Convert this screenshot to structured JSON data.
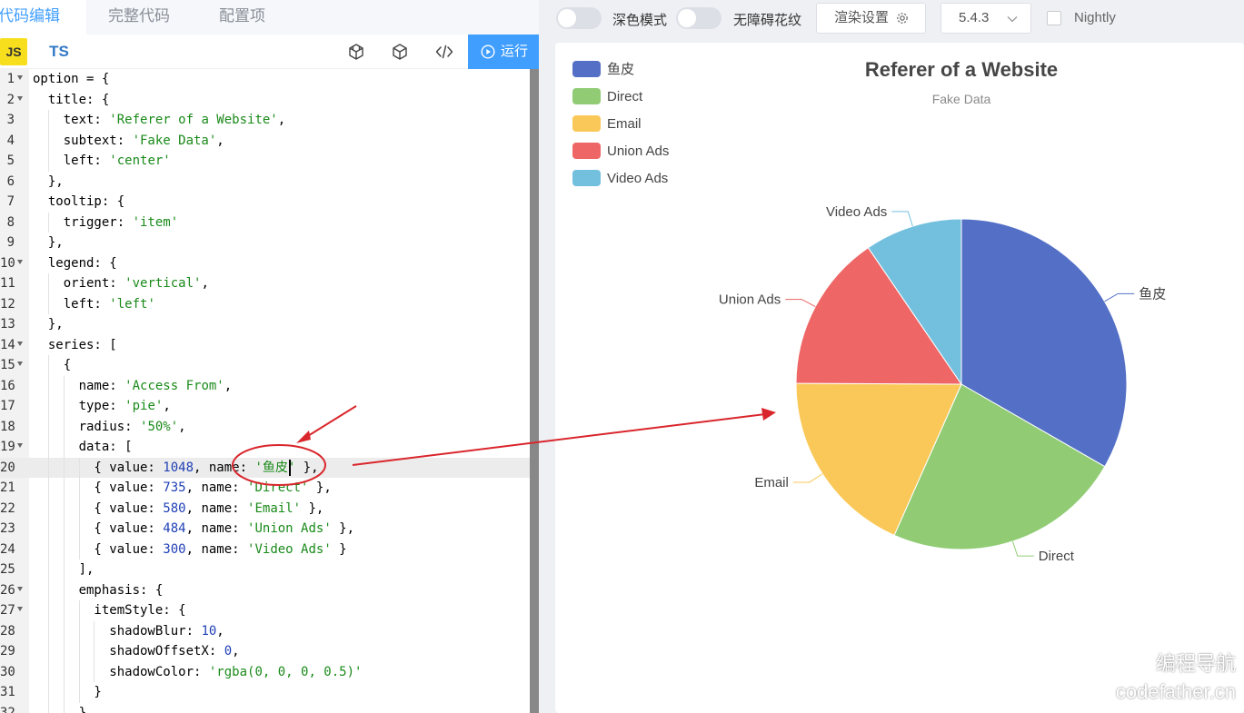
{
  "editor_tabs": [
    "代码编辑",
    "完整代码",
    "配置项"
  ],
  "toolbar": {
    "js_label": "JS",
    "ts_label": "TS",
    "run_label": "运行",
    "icons": [
      "codesandbox-icon",
      "cube-icon",
      "code-icon"
    ]
  },
  "code_lines": [
    [
      [
        "k",
        "option = {"
      ]
    ],
    [
      [
        "k",
        "  title: {"
      ]
    ],
    [
      [
        "k",
        "    text: "
      ],
      [
        "s",
        "'Referer of a Website'"
      ],
      [
        "k",
        ","
      ]
    ],
    [
      [
        "k",
        "    subtext: "
      ],
      [
        "s",
        "'Fake Data'"
      ],
      [
        "k",
        ","
      ]
    ],
    [
      [
        "k",
        "    left: "
      ],
      [
        "s",
        "'center'"
      ]
    ],
    [
      [
        "k",
        "  },"
      ]
    ],
    [
      [
        "k",
        "  tooltip: {"
      ]
    ],
    [
      [
        "k",
        "    trigger: "
      ],
      [
        "s",
        "'item'"
      ]
    ],
    [
      [
        "k",
        "  },"
      ]
    ],
    [
      [
        "k",
        "  legend: {"
      ]
    ],
    [
      [
        "k",
        "    orient: "
      ],
      [
        "s",
        "'vertical'"
      ],
      [
        "k",
        ","
      ]
    ],
    [
      [
        "k",
        "    left: "
      ],
      [
        "s",
        "'left'"
      ]
    ],
    [
      [
        "k",
        "  },"
      ]
    ],
    [
      [
        "k",
        "  series: ["
      ]
    ],
    [
      [
        "k",
        "    {"
      ]
    ],
    [
      [
        "k",
        "      name: "
      ],
      [
        "s",
        "'Access From'"
      ],
      [
        "k",
        ","
      ]
    ],
    [
      [
        "k",
        "      type: "
      ],
      [
        "s",
        "'pie'"
      ],
      [
        "k",
        ","
      ]
    ],
    [
      [
        "k",
        "      radius: "
      ],
      [
        "s",
        "'50%'"
      ],
      [
        "k",
        ","
      ]
    ],
    [
      [
        "k",
        "      data: ["
      ]
    ],
    [
      [
        "k",
        "        { value: "
      ],
      [
        "n",
        "1048"
      ],
      [
        "k",
        ", name: "
      ],
      [
        "s",
        "'鱼皮'"
      ],
      [
        "k",
        " },"
      ]
    ],
    [
      [
        "k",
        "        { value: "
      ],
      [
        "n",
        "735"
      ],
      [
        "k",
        ", name: "
      ],
      [
        "s",
        "'Direct'"
      ],
      [
        "k",
        " },"
      ]
    ],
    [
      [
        "k",
        "        { value: "
      ],
      [
        "n",
        "580"
      ],
      [
        "k",
        ", name: "
      ],
      [
        "s",
        "'Email'"
      ],
      [
        "k",
        " },"
      ]
    ],
    [
      [
        "k",
        "        { value: "
      ],
      [
        "n",
        "484"
      ],
      [
        "k",
        ", name: "
      ],
      [
        "s",
        "'Union Ads'"
      ],
      [
        "k",
        " },"
      ]
    ],
    [
      [
        "k",
        "        { value: "
      ],
      [
        "n",
        "300"
      ],
      [
        "k",
        ", name: "
      ],
      [
        "s",
        "'Video Ads'"
      ],
      [
        "k",
        " }"
      ]
    ],
    [
      [
        "k",
        "      ],"
      ]
    ],
    [
      [
        "k",
        "      emphasis: {"
      ]
    ],
    [
      [
        "k",
        "        itemStyle: {"
      ]
    ],
    [
      [
        "k",
        "          shadowBlur: "
      ],
      [
        "n",
        "10"
      ],
      [
        "k",
        ","
      ]
    ],
    [
      [
        "k",
        "          shadowOffsetX: "
      ],
      [
        "n",
        "0"
      ],
      [
        "k",
        ","
      ]
    ],
    [
      [
        "k",
        "          shadowColor: "
      ],
      [
        "s",
        "'rgba(0, 0, 0, 0.5)'"
      ]
    ],
    [
      [
        "k",
        "        }"
      ]
    ],
    [
      [
        "k",
        "      }"
      ]
    ]
  ],
  "fold_lines": [
    1,
    2,
    10,
    14,
    15,
    19,
    26,
    27
  ],
  "highlight_line": 20,
  "preview_controls": {
    "dark_mode_label": "深色模式",
    "accessibility_label": "无障碍花纹",
    "render_settings_label": "渲染设置",
    "version": "5.4.3",
    "nightly_label": "Nightly"
  },
  "chart_data": {
    "type": "pie",
    "title": "Referer of a Website",
    "subtitle": "Fake Data",
    "legend_position": "top-left",
    "series_name": "Access From",
    "slices": [
      {
        "name": "鱼皮",
        "value": 1048,
        "color": "#5470c6"
      },
      {
        "name": "Direct",
        "value": 735,
        "color": "#91cc75"
      },
      {
        "name": "Email",
        "value": 580,
        "color": "#fac858"
      },
      {
        "name": "Union Ads",
        "value": 484,
        "color": "#ee6666"
      },
      {
        "name": "Video Ads",
        "value": 300,
        "color": "#73c0de"
      }
    ]
  },
  "annotation_color": "#d9262c",
  "watermark": [
    "编程导航",
    "codefather.cn"
  ]
}
